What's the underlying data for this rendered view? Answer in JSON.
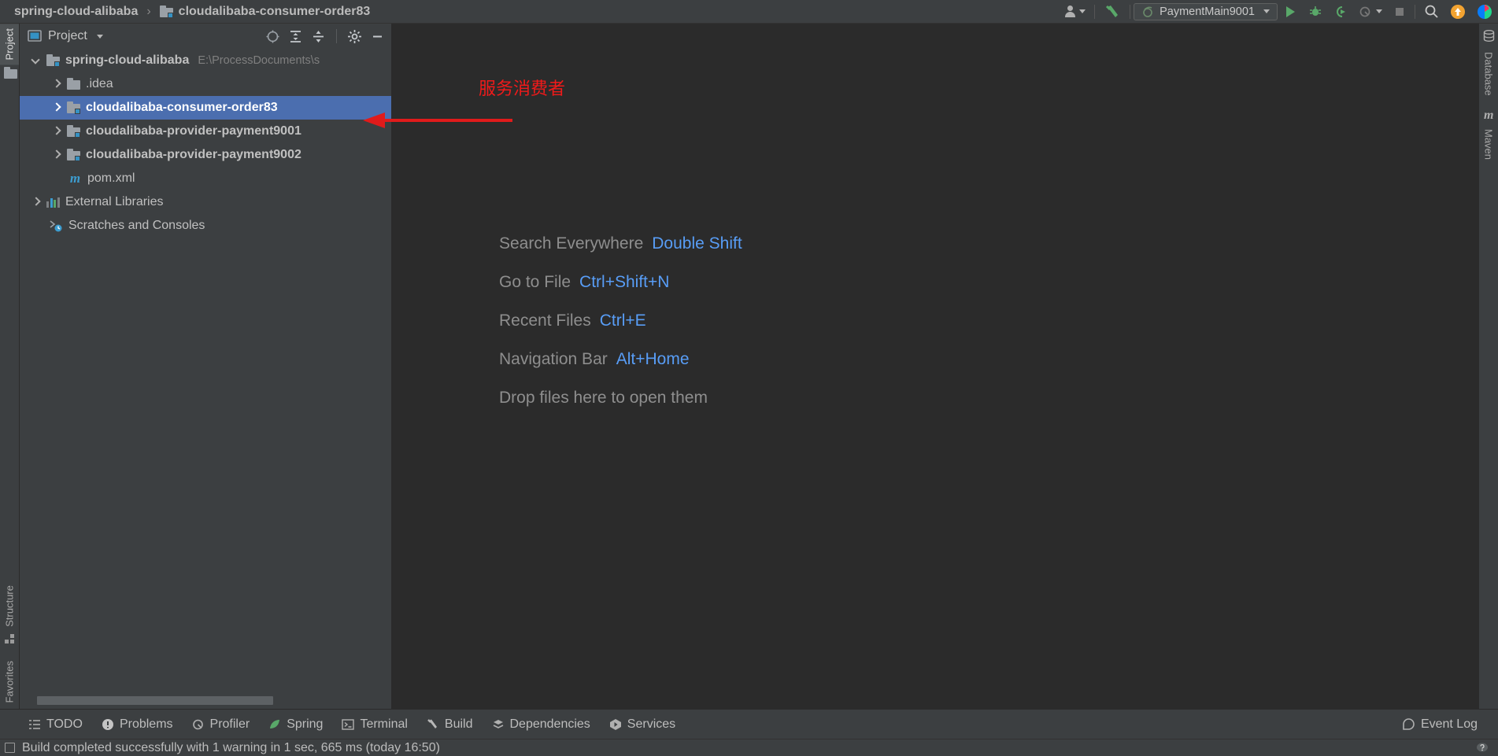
{
  "breadcrumb": {
    "root": "spring-cloud-alibaba",
    "separator": "›",
    "current": "cloudalibaba-consumer-order83"
  },
  "toolbar": {
    "user_icon": "user-icon",
    "build_icon": "build-hammer-icon",
    "run_config": "PaymentMain9001",
    "run_icon": "run-icon",
    "debug_icon": "debug-icon",
    "run_coverage_icon": "run-with-coverage-icon",
    "profile_icon": "profile-icon",
    "stop_icon": "stop-icon",
    "search_icon": "search-icon",
    "update_icon": "update-available-icon",
    "ide_icon": "intellij-logo-icon"
  },
  "left_strip": {
    "tabs": [
      {
        "label": "Project",
        "icon": "folder-icon",
        "active": true
      },
      {
        "label": "Structure",
        "icon": "structure-grid-icon",
        "active": false
      },
      {
        "label": "Favorites",
        "icon": "star-icon",
        "active": false
      }
    ]
  },
  "right_strip": {
    "tabs": [
      {
        "label": "Database",
        "icon": "database-icon"
      },
      {
        "label": "Maven",
        "icon": "maven-m-icon"
      }
    ]
  },
  "project_panel": {
    "title": "Project",
    "icons": [
      "select-opened-file-icon",
      "expand-all-icon",
      "collapse-all-icon",
      "settings-gear-icon",
      "hide-minimize-icon"
    ],
    "tree": [
      {
        "label": "spring-cloud-alibaba",
        "hint": "E:\\ProcessDocuments\\s",
        "icon": "module-folder-icon",
        "arrow": "down",
        "indent": 1,
        "bold": true,
        "selected": false
      },
      {
        "label": ".idea",
        "hint": "",
        "icon": "folder-icon",
        "arrow": "right",
        "indent": 2,
        "bold": false,
        "selected": false
      },
      {
        "label": "cloudalibaba-consumer-order83",
        "hint": "",
        "icon": "module-folder-icon",
        "arrow": "right",
        "indent": 2,
        "bold": true,
        "selected": true
      },
      {
        "label": "cloudalibaba-provider-payment9001",
        "hint": "",
        "icon": "module-folder-icon",
        "arrow": "right",
        "indent": 2,
        "bold": true,
        "selected": false
      },
      {
        "label": "cloudalibaba-provider-payment9002",
        "hint": "",
        "icon": "module-folder-icon",
        "arrow": "right",
        "indent": 2,
        "bold": true,
        "selected": false
      },
      {
        "label": "pom.xml",
        "hint": "",
        "icon": "maven-pom-icon",
        "arrow": "none",
        "indent": 3,
        "bold": false,
        "selected": false
      },
      {
        "label": "External Libraries",
        "hint": "",
        "icon": "external-libraries-icon",
        "arrow": "right",
        "indent": 1,
        "bold": false,
        "selected": false
      },
      {
        "label": "Scratches and Consoles",
        "hint": "",
        "icon": "scratches-icon",
        "arrow": "none",
        "indent": 1,
        "bold": false,
        "selected": false
      }
    ]
  },
  "editor": {
    "hints": [
      {
        "action": "Search Everywhere",
        "key": "Double Shift"
      },
      {
        "action": "Go to File",
        "key": "Ctrl+Shift+N"
      },
      {
        "action": "Recent Files",
        "key": "Ctrl+E"
      },
      {
        "action": "Navigation Bar",
        "key": "Alt+Home"
      },
      {
        "action": "Drop files here to open them",
        "key": ""
      }
    ]
  },
  "annotation": {
    "text": "服务消费者",
    "color": "#f01a1a"
  },
  "bottom_bar": {
    "items": [
      {
        "label": "TODO",
        "icon": "todo-list-icon"
      },
      {
        "label": "Problems",
        "icon": "problems-warning-icon"
      },
      {
        "label": "Profiler",
        "icon": "profiler-icon"
      },
      {
        "label": "Spring",
        "icon": "spring-leaf-icon"
      },
      {
        "label": "Terminal",
        "icon": "terminal-icon"
      },
      {
        "label": "Build",
        "icon": "build-hammer-icon"
      },
      {
        "label": "Dependencies",
        "icon": "dependencies-icon"
      },
      {
        "label": "Services",
        "icon": "services-icon"
      }
    ],
    "event_log": {
      "label": "Event Log",
      "icon": "event-log-icon"
    }
  },
  "status_bar": {
    "message": "Build completed successfully with 1 warning in 1 sec, 665 ms (today 16:50)",
    "right_icon": "help-balloon-icon"
  },
  "colors": {
    "selection": "#4b6eaf",
    "accent_blue": "#589df6",
    "annotation_red": "#f01a1a",
    "panel_bg": "#3c3f41",
    "editor_bg": "#2b2b2b"
  }
}
